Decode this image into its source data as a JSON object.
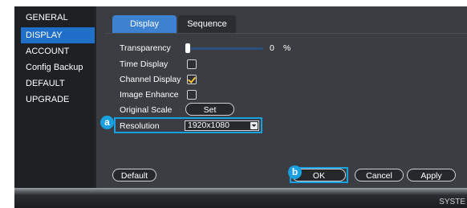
{
  "sidebar": {
    "items": [
      {
        "label": "GENERAL"
      },
      {
        "label": "DISPLAY"
      },
      {
        "label": "ACCOUNT"
      },
      {
        "label": "Config Backup"
      },
      {
        "label": "DEFAULT"
      },
      {
        "label": "UPGRADE"
      }
    ],
    "active": "DISPLAY"
  },
  "tabs": [
    {
      "label": "Display",
      "active": true
    },
    {
      "label": "Sequence",
      "active": false
    }
  ],
  "settings": {
    "transparency_label": "Transparency",
    "transparency_value": "0",
    "transparency_unit": "%",
    "time_display_label": "Time Display",
    "time_display_checked": false,
    "channel_display_label": "Channel Display",
    "channel_display_checked": true,
    "image_enhance_label": "Image Enhance",
    "image_enhance_checked": false,
    "original_scale_label": "Original Scale",
    "original_scale_button": "Set",
    "resolution_label": "Resolution",
    "resolution_value": "1920x1080"
  },
  "buttons": {
    "default": "Default",
    "ok": "OK",
    "cancel": "Cancel",
    "apply": "Apply"
  },
  "callouts": {
    "a": "a",
    "b": "b"
  },
  "status": {
    "bottom_text": "SYSTE"
  },
  "colors": {
    "accent": "#1aa0e0",
    "active_tab": "#3d82d0",
    "active_sidebar": "#1f6fc9",
    "check": "#f3c43a"
  }
}
